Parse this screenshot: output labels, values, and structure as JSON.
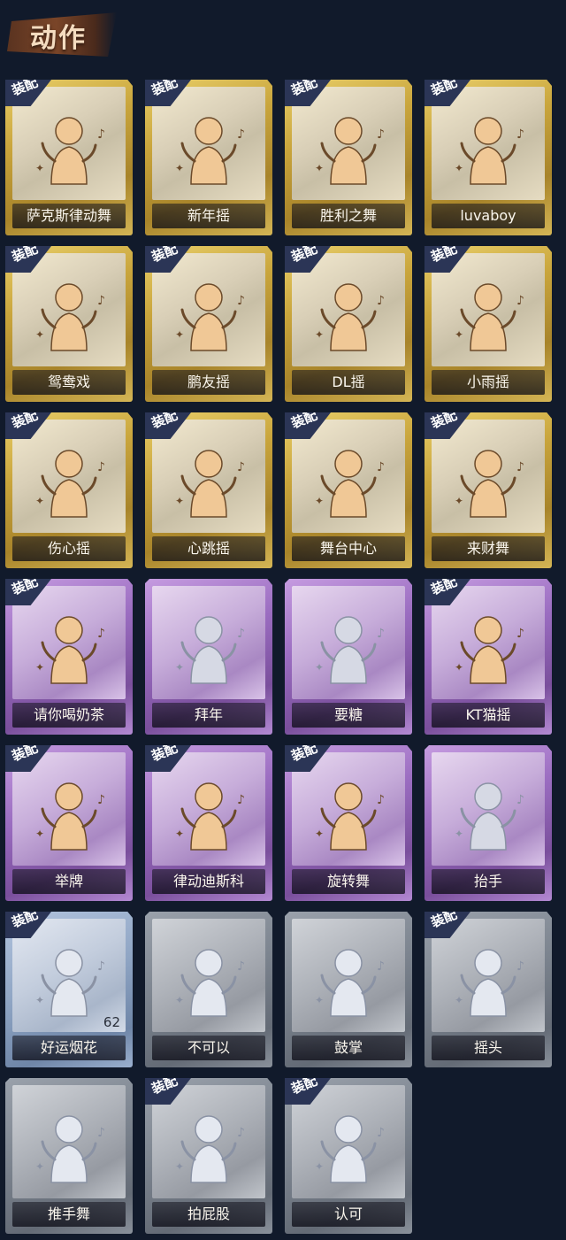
{
  "header": {
    "title": "动作"
  },
  "badge_label": "装配",
  "colors": {
    "gold": "#c9a53c",
    "purple": "#9a6cc0",
    "blue": "#8fa5c4",
    "grey": "#7b838e",
    "background": "#111a2b",
    "badge": "#2b3556"
  },
  "actions": [
    {
      "name": "萨克斯律动舞",
      "rarity": "gold",
      "equipped": true,
      "icon": "figure-dance-icon"
    },
    {
      "name": "新年摇",
      "rarity": "gold",
      "equipped": true,
      "icon": "figure-dance-icon"
    },
    {
      "name": "胜利之舞",
      "rarity": "gold",
      "equipped": true,
      "icon": "figure-dance-icon"
    },
    {
      "name": "luvaboy",
      "rarity": "gold",
      "equipped": true,
      "icon": "figure-dance-icon"
    },
    {
      "name": "鸳鸯戏",
      "rarity": "gold",
      "equipped": true,
      "icon": "figure-dance-icon"
    },
    {
      "name": "鹏友摇",
      "rarity": "gold",
      "equipped": true,
      "icon": "figure-dance-icon"
    },
    {
      "name": "DL摇",
      "rarity": "gold",
      "equipped": true,
      "icon": "figure-dance-icon"
    },
    {
      "name": "小雨摇",
      "rarity": "gold",
      "equipped": true,
      "icon": "figure-dance-icon"
    },
    {
      "name": "伤心摇",
      "rarity": "gold",
      "equipped": true,
      "icon": "figure-heart-icon"
    },
    {
      "name": "心跳摇",
      "rarity": "gold",
      "equipped": true,
      "icon": "figure-dance-icon"
    },
    {
      "name": "舞台中心",
      "rarity": "gold",
      "equipped": true,
      "icon": "figure-dance-icon"
    },
    {
      "name": "来财舞",
      "rarity": "gold",
      "equipped": true,
      "icon": "figure-dance-icon"
    },
    {
      "name": "请你喝奶茶",
      "rarity": "purple",
      "equipped": true,
      "icon": "figure-sign-icon"
    },
    {
      "name": "拜年",
      "rarity": "purple",
      "equipped": false,
      "icon": "figure-bow-icon"
    },
    {
      "name": "要糖",
      "rarity": "purple",
      "equipped": false,
      "icon": "figure-reach-icon"
    },
    {
      "name": "KT猫摇",
      "rarity": "purple",
      "equipped": true,
      "icon": "figure-dance-icon"
    },
    {
      "name": "举牌",
      "rarity": "purple",
      "equipped": true,
      "icon": "figure-sign-icon"
    },
    {
      "name": "律动迪斯科",
      "rarity": "purple",
      "equipped": true,
      "icon": "figure-dance-icon"
    },
    {
      "name": "旋转舞",
      "rarity": "purple",
      "equipped": true,
      "icon": "figure-spin-icon"
    },
    {
      "name": "抬手",
      "rarity": "purple",
      "equipped": false,
      "icon": "figure-raise-hand-icon"
    },
    {
      "name": "好运烟花",
      "rarity": "blue",
      "equipped": true,
      "icon": "firework-icon",
      "count": "62"
    },
    {
      "name": "不可以",
      "rarity": "grey",
      "equipped": false,
      "icon": "finger-wag-icon"
    },
    {
      "name": "鼓掌",
      "rarity": "grey",
      "equipped": false,
      "icon": "clap-hands-icon"
    },
    {
      "name": "摇头",
      "rarity": "grey",
      "equipped": true,
      "icon": "figure-shake-head-icon"
    },
    {
      "name": "推手舞",
      "rarity": "grey",
      "equipped": false,
      "icon": "figure-push-icon"
    },
    {
      "name": "拍屁股",
      "rarity": "grey",
      "equipped": true,
      "icon": "figure-pat-icon"
    },
    {
      "name": "认可",
      "rarity": "grey",
      "equipped": true,
      "icon": "thumbs-up-icon"
    }
  ]
}
